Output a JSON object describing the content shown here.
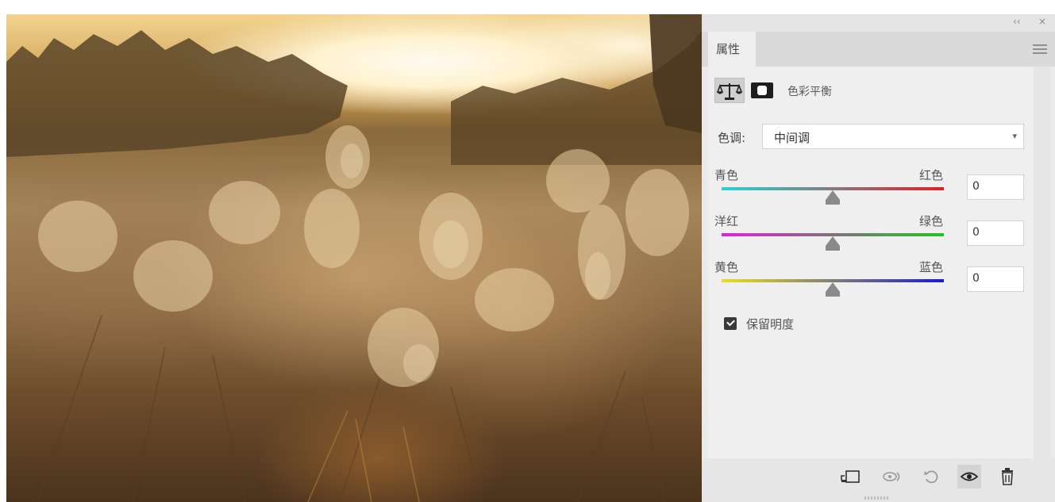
{
  "panel": {
    "collapse_glyph": "‹‹",
    "close_glyph": "×",
    "tab_label": "属性",
    "menu_icon": "hamburger-menu-icon"
  },
  "adjustment": {
    "title": "色彩平衡",
    "icon": "balance-scale-icon",
    "mask_icon": "layer-mask-icon"
  },
  "tone": {
    "label": "色调:",
    "selected": "中间调"
  },
  "sliders": [
    {
      "left": "青色",
      "right": "红色",
      "value": "0",
      "value_level": 0.5,
      "color_left": "#29d3d3",
      "color_right": "#e0202a"
    },
    {
      "left": "洋红",
      "right": "绿色",
      "value": "0",
      "value_level": 0.5,
      "color_left": "#e020d8",
      "color_right": "#22c422"
    },
    {
      "left": "黄色",
      "right": "蓝色",
      "value": "0",
      "value_level": 0.5,
      "color_left": "#e8e020",
      "color_right": "#1a1ad0"
    }
  ],
  "preserve_luminosity": {
    "label": "保留明度",
    "checked": true
  },
  "bottom_toolbar": [
    {
      "name": "clip-to-layer-icon",
      "active": false
    },
    {
      "name": "view-previous-state-icon",
      "active": false
    },
    {
      "name": "reset-icon",
      "active": false
    },
    {
      "name": "visibility-eye-icon",
      "active": true
    },
    {
      "name": "trash-icon",
      "active": false
    }
  ]
}
